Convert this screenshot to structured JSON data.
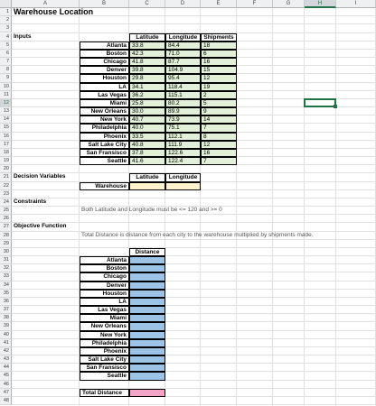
{
  "columns": [
    "A",
    "B",
    "C",
    "D",
    "E",
    "F",
    "G",
    "H",
    "I"
  ],
  "active_column": "H",
  "active_row": "12",
  "rows": [
    "1",
    "2",
    "3",
    "4",
    "5",
    "6",
    "7",
    "8",
    "9",
    "10",
    "11",
    "12",
    "13",
    "14",
    "15",
    "16",
    "17",
    "18",
    "19",
    "20",
    "21",
    "22",
    "23",
    "24",
    "25",
    "26",
    "27",
    "28",
    "29",
    "30",
    "31",
    "32",
    "33",
    "34",
    "35",
    "36",
    "37",
    "38",
    "39",
    "40",
    "41",
    "42",
    "43",
    "44",
    "45",
    "46",
    "47",
    "48"
  ],
  "title": "Warehouse Location",
  "inputs": {
    "section_label": "Inputs",
    "headers": [
      "Latitude",
      "Longitude",
      "Shipments"
    ],
    "rows": [
      {
        "city": "Atlanta",
        "lat": "33.8",
        "lon": "84.4",
        "ship": "18"
      },
      {
        "city": "Boston",
        "lat": "42.3",
        "lon": "71.0",
        "ship": "6"
      },
      {
        "city": "Chicago",
        "lat": "41.8",
        "lon": "87.7",
        "ship": "16"
      },
      {
        "city": "Denver",
        "lat": "39.8",
        "lon": "104.9",
        "ship": "15"
      },
      {
        "city": "Houston",
        "lat": "29.8",
        "lon": "95.4",
        "ship": "12"
      },
      {
        "city": "LA",
        "lat": "34.1",
        "lon": "118.4",
        "ship": "19"
      },
      {
        "city": "Las Vegas",
        "lat": "36.2",
        "lon": "115.1",
        "ship": "2"
      },
      {
        "city": "Miami",
        "lat": "25.8",
        "lon": "80.2",
        "ship": "5"
      },
      {
        "city": "New Orleans",
        "lat": "30.0",
        "lon": "89.9",
        "ship": "9"
      },
      {
        "city": "New York",
        "lat": "40.7",
        "lon": "73.9",
        "ship": "14"
      },
      {
        "city": "Philadelphia",
        "lat": "40.0",
        "lon": "75.1",
        "ship": "7"
      },
      {
        "city": "Phoenix",
        "lat": "33.5",
        "lon": "112.1",
        "ship": "8"
      },
      {
        "city": "Salt Lake City",
        "lat": "40.8",
        "lon": "111.9",
        "ship": "12"
      },
      {
        "city": "San Fransisco",
        "lat": "37.8",
        "lon": "122.6",
        "ship": "16"
      },
      {
        "city": "Seattle",
        "lat": "41.6",
        "lon": "122.4",
        "ship": "7"
      }
    ]
  },
  "decision": {
    "section_label": "Decision Variables",
    "headers": [
      "Latitude",
      "Longitude"
    ],
    "row_label": "Warehouse"
  },
  "constraints": {
    "section_label": "Constraints",
    "text": "Both Latitude and Longitude must be <= 120 and >= 0"
  },
  "objective": {
    "section_label": "Objective Function",
    "text": "Total Distance is distance from each city to the warehouse multiplied by shipments made.",
    "distance_header": "Distance",
    "cities": [
      "Atlanta",
      "Boston",
      "Chicago",
      "Denver",
      "Houston",
      "LA",
      "Las Vegas",
      "Miami",
      "New Orleans",
      "New York",
      "Philadelphia",
      "Phoenix",
      "Salt Lake City",
      "San Fransisco",
      "Seattle"
    ],
    "total_label": "Total Distance"
  }
}
